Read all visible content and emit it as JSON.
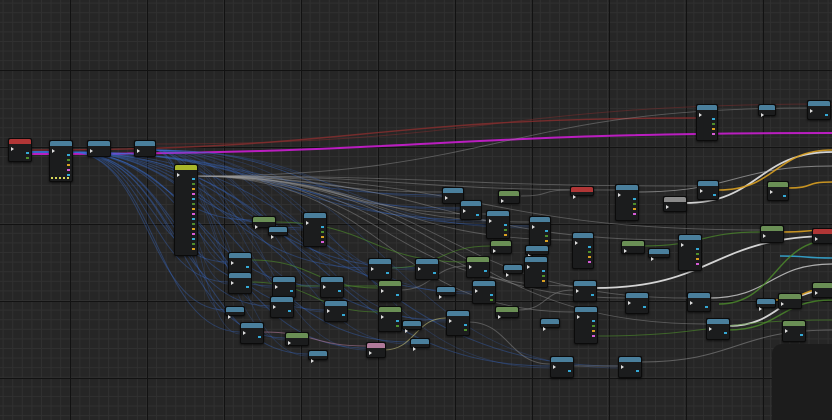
{
  "graph": {
    "colors": {
      "background": "#262626",
      "grid_major": "#121212",
      "grid_minor": "#303030",
      "exec_wire": "#e8e8e8",
      "magenta_wire": "#c21ec8",
      "blue_wire": "#3a6fd8",
      "green_wire": "#4e8f2c",
      "orange_wire": "#d9a021",
      "cyan_wire": "#35a8d4",
      "red_wire": "#8a2e2e",
      "header_blue": "#4a7f9c",
      "header_green": "#6a8f55",
      "header_red": "#b03636",
      "header_yellow": "#a8b52a",
      "header_pink": "#b07a9a",
      "header_gray": "#8a8a8a"
    },
    "node_count": 62,
    "icons": [
      "exec-pin-icon",
      "data-pin-icon"
    ]
  }
}
